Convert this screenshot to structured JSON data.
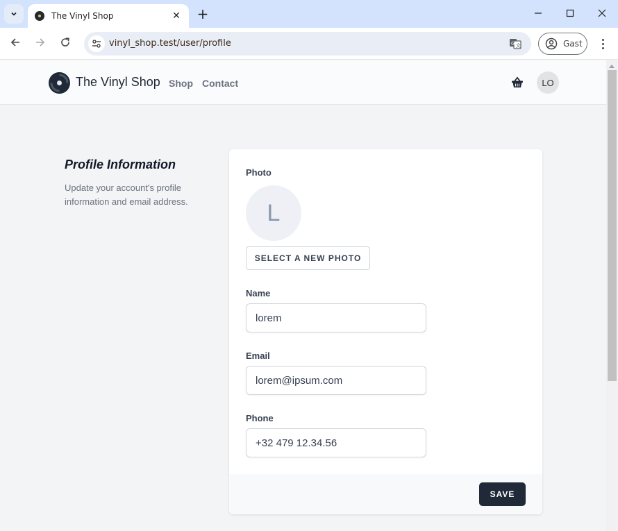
{
  "browser": {
    "tab_title": "The Vinyl Shop",
    "url": "vinyl_shop.test/user/profile",
    "profile_label": "Gast",
    "new_tab_symbol": "+",
    "close_symbol": "✕",
    "minimize_symbol": "—",
    "maximize_symbol": "☐",
    "window_close_symbol": "✕",
    "back_symbol": "←",
    "forward_symbol": "→",
    "reload_symbol": "↻"
  },
  "header": {
    "brand": "The Vinyl Shop",
    "nav": [
      {
        "label": "Shop"
      },
      {
        "label": "Contact"
      }
    ],
    "user_initials": "LO"
  },
  "profile_section": {
    "title": "Profile Information",
    "description": "Update your account's profile information and email address."
  },
  "form": {
    "photo_label": "Photo",
    "photo_initial": "L",
    "select_photo_label": "SELECT A NEW PHOTO",
    "name_label": "Name",
    "name_value": "lorem",
    "email_label": "Email",
    "email_value": "lorem@ipsum.com",
    "phone_label": "Phone",
    "phone_value": "+32 479 12.34.56",
    "save_label": "SAVE"
  },
  "colors": {
    "tabstrip": "#d3e3fd",
    "page_bg": "#f3f4f6",
    "primary_button": "#1f2937"
  }
}
